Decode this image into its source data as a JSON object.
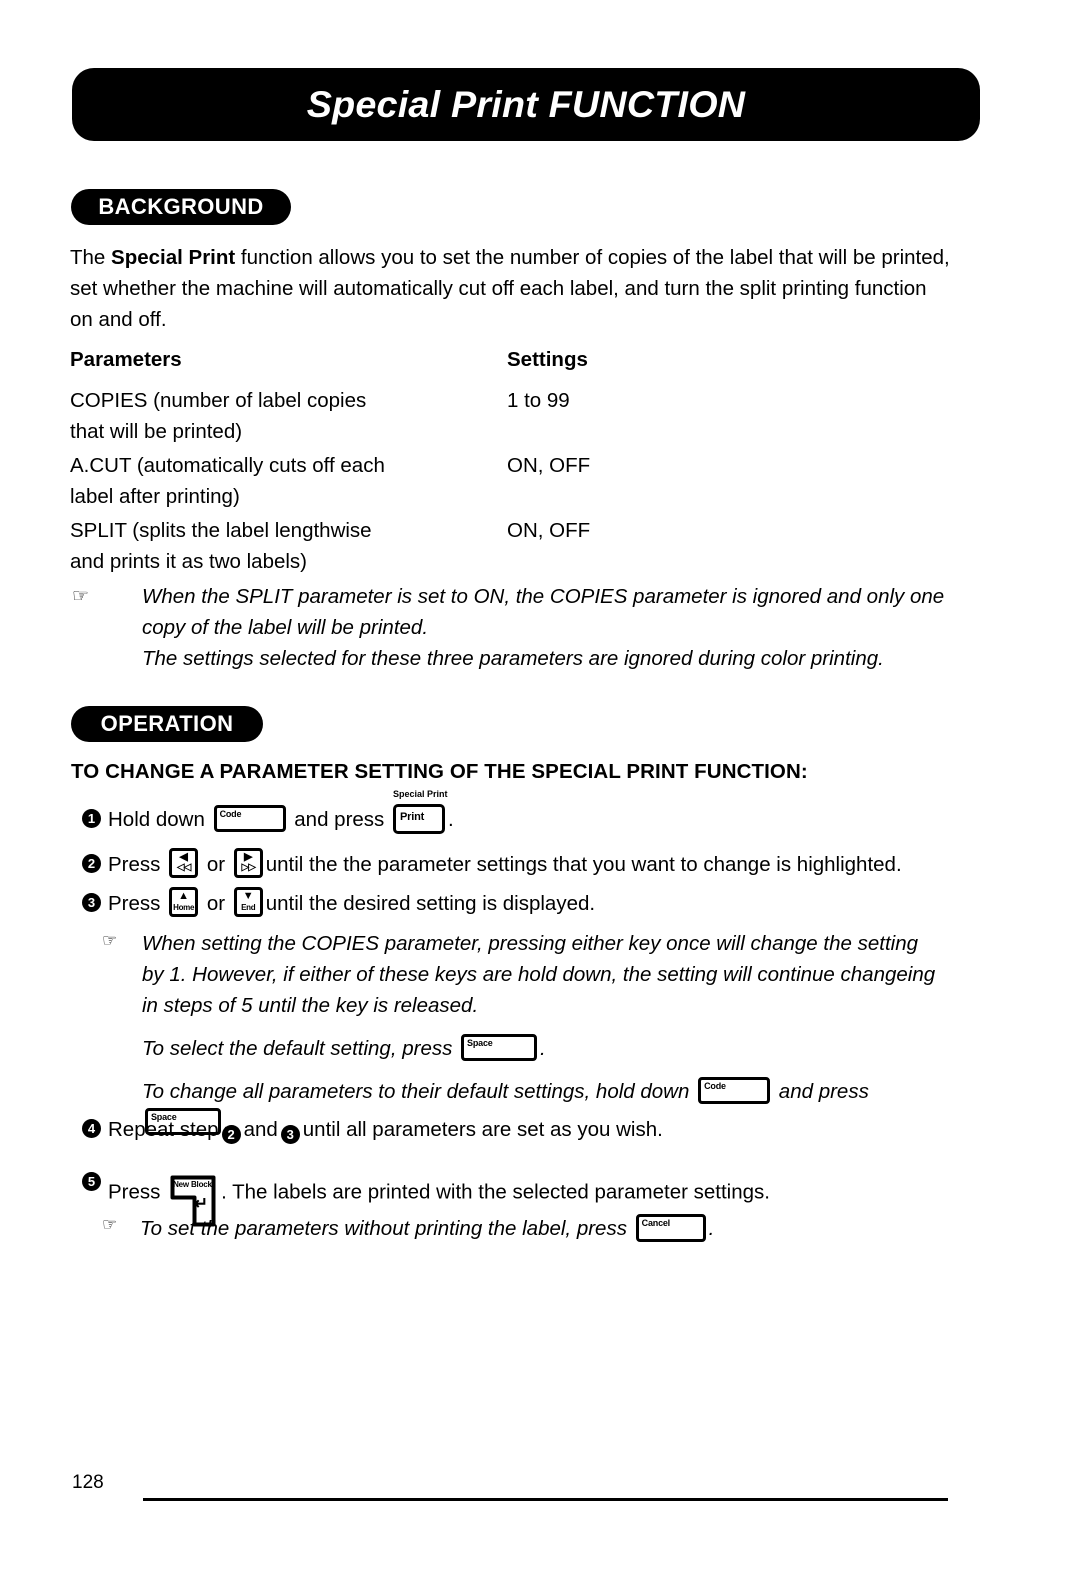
{
  "document": {
    "title": "Special Print FUNCTION",
    "page_number": "128"
  },
  "sections": {
    "background": {
      "pill_label": "BACKGROUND",
      "intro_prefix": "The ",
      "intro_bold": "Special Print",
      "intro_rest": " function allows you to set the number of copies of the label that will be printed, set whether the machine will automatically cut off each label, and turn the split printing function on and off.",
      "table": {
        "header_parameters": "Parameters",
        "header_settings": "Settings",
        "rows": [
          {
            "parameter_line1": "COPIES (number of label copies",
            "parameter_line2": "that will be printed)",
            "setting": "1 to 99"
          },
          {
            "parameter_line1": "A.CUT (automatically cuts off each",
            "parameter_line2": "label after printing)",
            "setting": "ON, OFF"
          },
          {
            "parameter_line1": "SPLIT (splits the label lengthwise",
            "parameter_line2": "and prints it as two labels)",
            "setting": "ON, OFF"
          }
        ]
      },
      "note": {
        "icon": "pointing-hand-icon",
        "icon_glyph": "☞",
        "line1": "When the SPLIT parameter is set to ON, the COPIES parameter is ignored and only one copy of the label will be printed.",
        "line2": "The settings selected for these three parameters are ignored during color printing."
      }
    },
    "operation": {
      "pill_label": "OPERATION",
      "subheading": "TO CHANGE A PARAMETER SETTING OF THE SPECIAL PRINT FUNCTION:",
      "steps": {
        "step1": {
          "number": "1",
          "text_before_key": "Hold down",
          "key_code": "Code",
          "text_between": "and press",
          "key_print_caption": "Special Print",
          "key_print": "Print",
          "text_after": "."
        },
        "step2": {
          "number": "2",
          "text_before": "Press",
          "key_left_top": "◀",
          "key_left_bottom": "◁◁",
          "text_or": "or",
          "key_right_top": "▶",
          "key_right_bottom": "▷▷",
          "text_after": "until the the parameter settings that you want to change is highlighted."
        },
        "step3": {
          "number": "3",
          "text_before": "Press",
          "key_up_glyph": "▲",
          "key_up_word": "Home",
          "text_or": "or",
          "key_down_glyph": "▼",
          "key_down_word": "End",
          "text_after": "until the desired setting is displayed."
        },
        "step4": {
          "number": "4",
          "text_before": "Repeat step",
          "ref_a": "2",
          "text_and": "and",
          "ref_b": "3",
          "text_after": "until all parameters are set as you wish."
        },
        "step5": {
          "number": "5",
          "text_before": "Press",
          "key_enter_caption": "New Block",
          "key_enter_glyph": "↵",
          "text_after": ".  The labels are printed with the selected parameter settings."
        }
      },
      "note_copies": {
        "icon_glyph": "☞",
        "paragraph": "When setting the COPIES parameter, pressing either key once will change the setting by 1.  However, if either of these keys are hold down, the setting will continue changeing in steps of 5 until the key is released.",
        "default_line_before": "To select the default setting, press",
        "default_key": "Space",
        "default_line_after": ".",
        "all_defaults_before": "To change all parameters to their default settings, hold down",
        "all_defaults_key_code": "Code",
        "all_defaults_middle": "and press",
        "all_defaults_key_space": "Space",
        "all_defaults_after": "."
      },
      "note_cancel": {
        "icon_glyph": "☞",
        "text_before": "To set the parameters without printing the label, press",
        "key_cancel": "Cancel",
        "text_after": "."
      }
    }
  },
  "colors": {
    "ink": "#000000",
    "paper": "#ffffff"
  }
}
